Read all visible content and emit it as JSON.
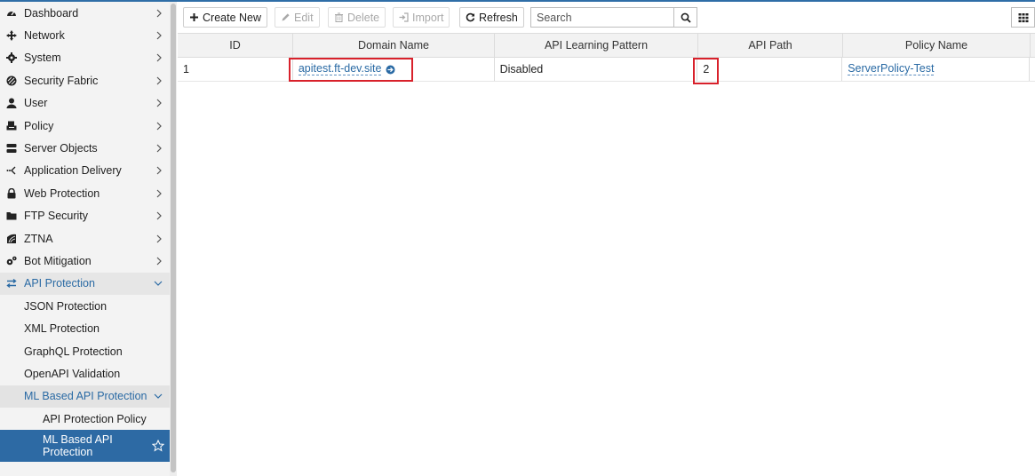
{
  "colors": {
    "accent": "#2d6aa4",
    "highlight": "#d8212b"
  },
  "sidebar": {
    "items": [
      {
        "label": "Dashboard",
        "icon": "dashboard-icon"
      },
      {
        "label": "Network",
        "icon": "network-icon"
      },
      {
        "label": "System",
        "icon": "gear-icon"
      },
      {
        "label": "Security Fabric",
        "icon": "security-fabric-icon"
      },
      {
        "label": "User",
        "icon": "user-icon"
      },
      {
        "label": "Policy",
        "icon": "policy-icon"
      },
      {
        "label": "Server Objects",
        "icon": "server-icon"
      },
      {
        "label": "Application Delivery",
        "icon": "app-delivery-icon"
      },
      {
        "label": "Web Protection",
        "icon": "lock-icon"
      },
      {
        "label": "FTP Security",
        "icon": "folder-icon"
      },
      {
        "label": "ZTNA",
        "icon": "ztna-icon"
      },
      {
        "label": "Bot Mitigation",
        "icon": "bot-icon"
      },
      {
        "label": "API Protection",
        "icon": "arrows-exchange-icon"
      }
    ],
    "api_sub": [
      {
        "label": "JSON Protection"
      },
      {
        "label": "XML Protection"
      },
      {
        "label": "GraphQL Protection"
      },
      {
        "label": "OpenAPI Validation"
      }
    ],
    "ml_group": {
      "label": "ML Based API Protection"
    },
    "ml_sub": [
      {
        "label": "API Protection Policy"
      },
      {
        "label": "ML Based API Protection"
      }
    ]
  },
  "toolbar": {
    "create": "Create New",
    "edit": "Edit",
    "delete": "Delete",
    "import": "Import",
    "refresh": "Refresh",
    "search_placeholder": "Search"
  },
  "table": {
    "headers": [
      "ID",
      "Domain Name",
      "API Learning Pattern",
      "API Path",
      "Policy Name"
    ],
    "rows": [
      {
        "id": "1",
        "domain": "apitest.ft-dev.site",
        "pattern": "Disabled",
        "api_path": "2",
        "policy": "ServerPolicy-Test"
      }
    ]
  }
}
